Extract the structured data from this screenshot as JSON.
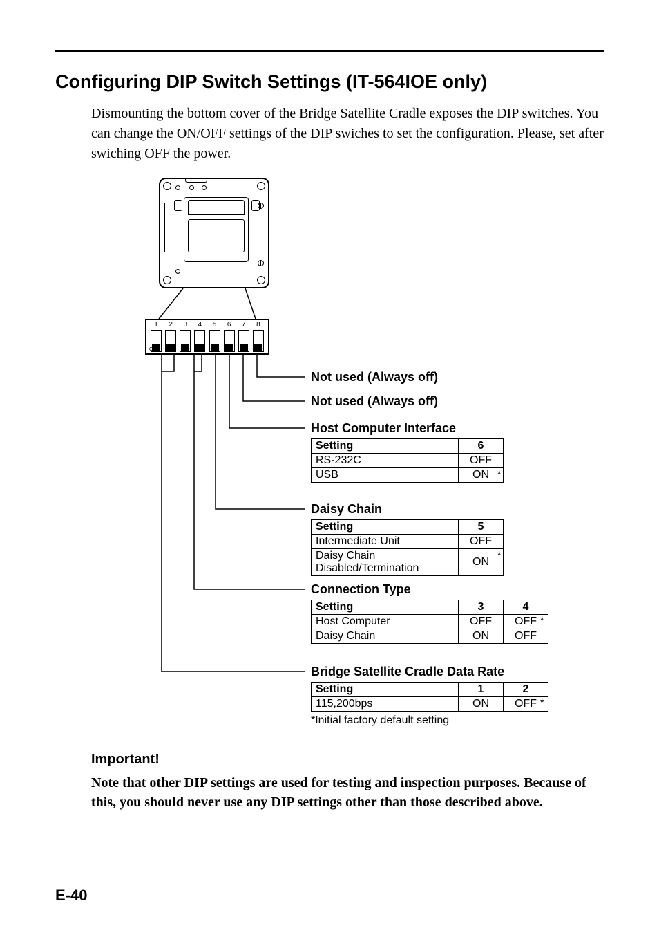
{
  "title": "Configuring DIP Switch Settings (IT-564IOE only)",
  "intro": "Dismounting the bottom cover of the Bridge Satellite Cradle exposes the DIP switches. You can change the ON/OFF settings of the DIP swiches to set the configuration. Please, set after swiching OFF the power.",
  "dip_numbers": [
    "1",
    "2",
    "3",
    "4",
    "5",
    "6",
    "7",
    "8"
  ],
  "off_label": "OFF",
  "sections": {
    "s8": "Not used (Always off)",
    "s7": "Not used (Always off)",
    "s6": {
      "title": "Host Computer Interface",
      "head": [
        "Setting",
        "6"
      ],
      "rows": [
        [
          "RS-232C",
          "OFF"
        ],
        [
          "USB",
          "ON"
        ]
      ],
      "default_row": 1
    },
    "s5": {
      "title": "Daisy Chain",
      "head": [
        "Setting",
        "5"
      ],
      "rows": [
        [
          "Intermediate Unit",
          "OFF"
        ],
        [
          "Daisy Chain Disabled/Termination",
          "ON"
        ]
      ],
      "default_row": 1
    },
    "s34": {
      "title": "Connection Type",
      "head": [
        "Setting",
        "3",
        "4"
      ],
      "rows": [
        [
          "Host Computer",
          "OFF",
          "OFF"
        ],
        [
          "Daisy Chain",
          "ON",
          "OFF"
        ]
      ],
      "default_row": 0
    },
    "s12": {
      "title": "Bridge Satellite Cradle Data Rate",
      "head": [
        "Setting",
        "1",
        "2"
      ],
      "rows": [
        [
          "115,200bps",
          "ON",
          "OFF"
        ]
      ],
      "default_row": 0
    },
    "footnote": "*Initial factory default setting"
  },
  "important": {
    "heading": "Important!",
    "body": "Note that other DIP settings are used for testing and inspection purposes. Because of this, you should never use any DIP settings other than those described above."
  },
  "page_number": "E-40"
}
